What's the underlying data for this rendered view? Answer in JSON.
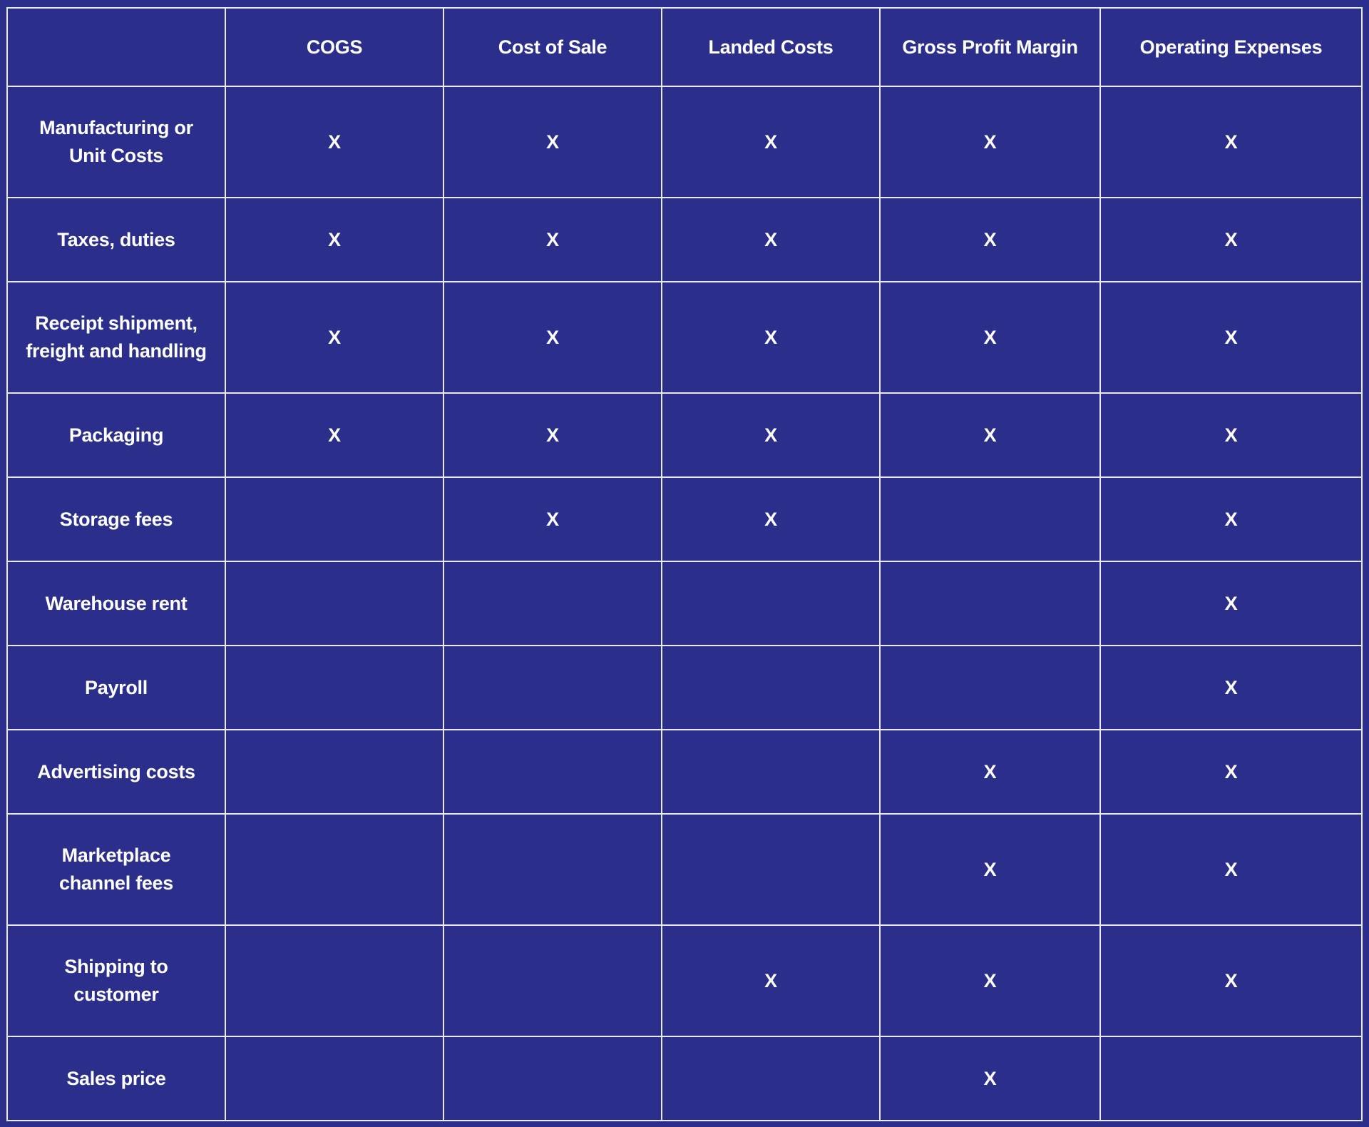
{
  "table": {
    "corner": "",
    "columns": [
      "COGS",
      "Cost of Sale",
      "Landed Costs",
      "Gross Profit Margin",
      "Operating Expenses"
    ],
    "mark_symbol": "X",
    "rows": [
      {
        "label_lines": [
          "Manufacturing or",
          "Unit Costs"
        ],
        "cells": [
          "X",
          "X",
          "X",
          "X",
          "X"
        ]
      },
      {
        "label_lines": [
          "Taxes, duties"
        ],
        "cells": [
          "X",
          "X",
          "X",
          "X",
          "X"
        ]
      },
      {
        "label_lines": [
          "Receipt shipment,",
          "freight and handling"
        ],
        "cells": [
          "X",
          "X",
          "X",
          "X",
          "X"
        ]
      },
      {
        "label_lines": [
          "Packaging"
        ],
        "cells": [
          "X",
          "X",
          "X",
          "X",
          "X"
        ]
      },
      {
        "label_lines": [
          "Storage fees"
        ],
        "cells": [
          "",
          "X",
          "X",
          "",
          "X"
        ]
      },
      {
        "label_lines": [
          "Warehouse rent"
        ],
        "cells": [
          "",
          "",
          "",
          "",
          "X"
        ]
      },
      {
        "label_lines": [
          "Payroll"
        ],
        "cells": [
          "",
          "",
          "",
          "",
          "X"
        ]
      },
      {
        "label_lines": [
          "Advertising costs"
        ],
        "cells": [
          "",
          "",
          "",
          "X",
          "X"
        ]
      },
      {
        "label_lines": [
          "Marketplace",
          "channel fees"
        ],
        "cells": [
          "",
          "",
          "",
          "X",
          "X"
        ]
      },
      {
        "label_lines": [
          "Shipping to",
          "customer"
        ],
        "cells": [
          "",
          "",
          "X",
          "X",
          "X"
        ]
      },
      {
        "label_lines": [
          "Sales price"
        ],
        "cells": [
          "",
          "",
          "",
          "X",
          ""
        ]
      }
    ]
  },
  "colors": {
    "background": "#2b2f8b",
    "grid_lines": "#e9e9f2",
    "text": "#ffffff"
  }
}
